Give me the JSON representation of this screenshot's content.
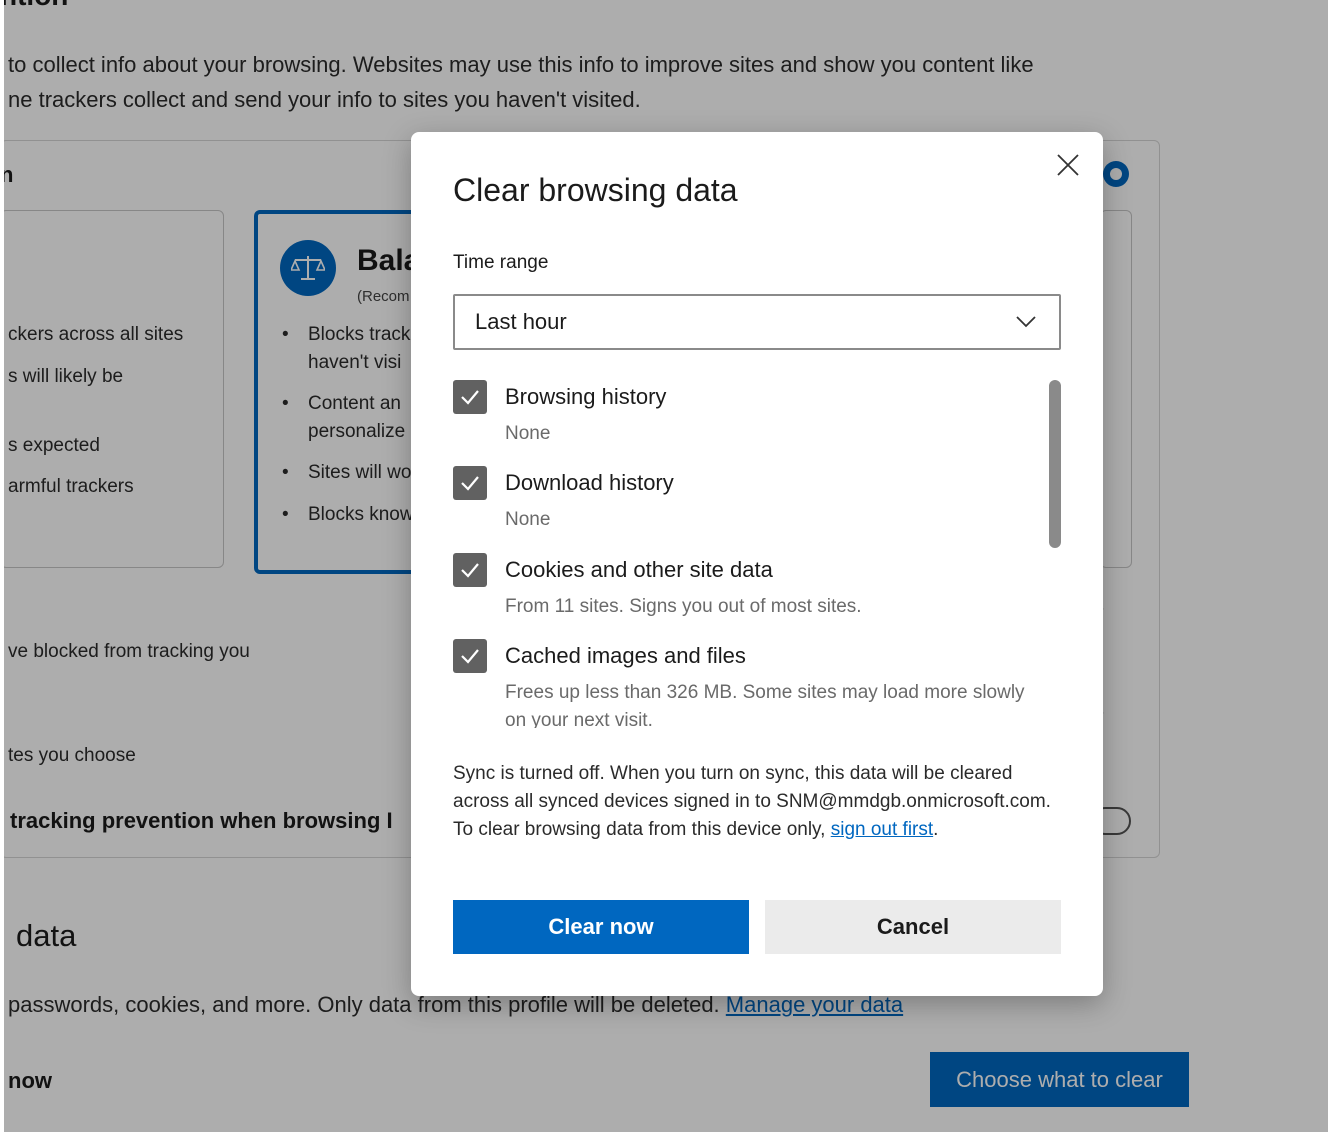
{
  "background": {
    "heading_top": "ntion",
    "desc_line1": "to collect info about your browsing. Websites may use this info to improve sites and show you content like",
    "desc_line2": "ne trackers collect and send your info to sites you haven't visited.",
    "card_header": "n",
    "basic": {
      "line1": "ckers across all sites",
      "line2": "s will likely be",
      "line3": "s expected",
      "line4": "armful trackers"
    },
    "balanced": {
      "title": "Bala",
      "subtitle": "(Recom",
      "bullets": [
        "Blocks track",
        "haven't visi",
        "Content an",
        "personalize",
        "Sites will wo",
        "Blocks know"
      ]
    },
    "blocked_link": "ve blocked from tracking you",
    "exceptions": "tes you choose",
    "always_strict": "tracking prevention when browsing I",
    "clear_data_heading": "data",
    "clear_data_desc": "passwords, cookies, and more. Only data from this profile will be deleted.",
    "manage_link": "Manage your data",
    "now_label": "now",
    "choose_button": "Choose what to clear"
  },
  "dialog": {
    "title": "Clear browsing data",
    "time_range_label": "Time range",
    "time_range_value": "Last hour",
    "items": [
      {
        "title": "Browsing history",
        "detail": "None",
        "checked": true
      },
      {
        "title": "Download history",
        "detail": "None",
        "checked": true
      },
      {
        "title": "Cookies and other site data",
        "detail": "From 11 sites. Signs you out of most sites.",
        "checked": true
      },
      {
        "title": "Cached images and files",
        "detail": "Frees up less than 326 MB. Some sites may load more slowly on your next visit.",
        "checked": true
      }
    ],
    "sync_text": "Sync is turned off. When you turn on sync, this data will be cleared across all synced devices signed in to SNM@mmdgb.onmicrosoft.com. To clear browsing data from this device only,",
    "sign_out_link": "sign out first",
    "sync_end": ".",
    "clear_button": "Clear now",
    "cancel_button": "Cancel"
  }
}
